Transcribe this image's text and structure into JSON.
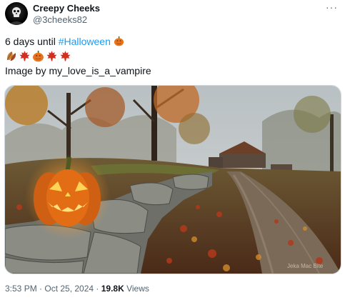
{
  "author": {
    "display_name": "Creepy Cheeks",
    "handle": "@3cheeks82",
    "avatar_icon": "skull-avatar-icon"
  },
  "more_icon": "···",
  "text": {
    "line1_prefix": "6 days until ",
    "hashtag": "#Halloween",
    "emoji_line": [
      "leaf-icon",
      "maple-leaf-icon",
      "jack-o-lantern-icon",
      "maple-leaf-icon",
      "maple-leaf-icon"
    ],
    "credit": "Image by my_love_is_a_vampire"
  },
  "image": {
    "description_icon": "jack-o-lantern-farm-road-photo",
    "watermark": "Jeka Mac Bite"
  },
  "meta": {
    "time_date": "3:53 PM · Oct 25, 2024 · ",
    "views_count": "19.8K",
    "views_label": " Views"
  },
  "colors": {
    "link": "#1d9bf0",
    "pumpkin": "#e8731a",
    "leaf_red": "#d22f1f"
  }
}
